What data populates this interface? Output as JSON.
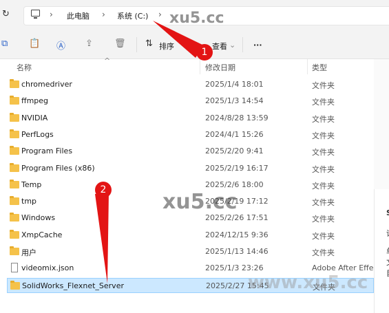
{
  "address": {
    "refresh_icon": "refresh-icon",
    "computer_icon": "computer-icon",
    "crumbs": [
      "此电脑",
      "系统 (C:)"
    ]
  },
  "toolbar": {
    "sort_label": "排序",
    "view_label": "查看",
    "more_label": "···"
  },
  "columns": {
    "name": "名称",
    "date": "修改日期",
    "type": "类型"
  },
  "files": [
    {
      "name": "chromedriver",
      "date": "2025/1/4 18:01",
      "type": "文件夹",
      "kind": "folder"
    },
    {
      "name": "ffmpeg",
      "date": "2025/1/3 14:54",
      "type": "文件夹",
      "kind": "folder"
    },
    {
      "name": "NVIDIA",
      "date": "2024/8/28 13:59",
      "type": "文件夹",
      "kind": "folder"
    },
    {
      "name": "PerfLogs",
      "date": "2024/4/1 15:26",
      "type": "文件夹",
      "kind": "folder"
    },
    {
      "name": "Program Files",
      "date": "2025/2/20 9:41",
      "type": "文件夹",
      "kind": "folder"
    },
    {
      "name": "Program Files (x86)",
      "date": "2025/2/19 16:17",
      "type": "文件夹",
      "kind": "folder"
    },
    {
      "name": "Temp",
      "date": "2025/2/6 18:00",
      "type": "文件夹",
      "kind": "folder"
    },
    {
      "name": "tmp",
      "date": "2025/2/19 17:12",
      "type": "文件夹",
      "kind": "folder"
    },
    {
      "name": "Windows",
      "date": "2025/2/26 17:51",
      "type": "文件夹",
      "kind": "folder"
    },
    {
      "name": "XmpCache",
      "date": "2024/12/15 9:36",
      "type": "文件夹",
      "kind": "folder"
    },
    {
      "name": "用户",
      "date": "2025/1/13 14:46",
      "type": "文件夹",
      "kind": "folder"
    },
    {
      "name": "videomix.json",
      "date": "2025/1/3 23:26",
      "type": "Adobe After Effec",
      "kind": "file"
    },
    {
      "name": "SolidWorks_Flexnet_Server",
      "date": "2025/2/27 15:45",
      "type": "文件夹",
      "kind": "folder",
      "selected": true
    }
  ],
  "annotations": [
    {
      "label": "1"
    },
    {
      "label": "2"
    }
  ],
  "watermarks": [
    "xu5.cc",
    "xu5.cc",
    "www.xu5.cc"
  ],
  "colors": {
    "accent": "#2b62c8",
    "selection": "#cce8ff",
    "arrow": "#e31414"
  }
}
